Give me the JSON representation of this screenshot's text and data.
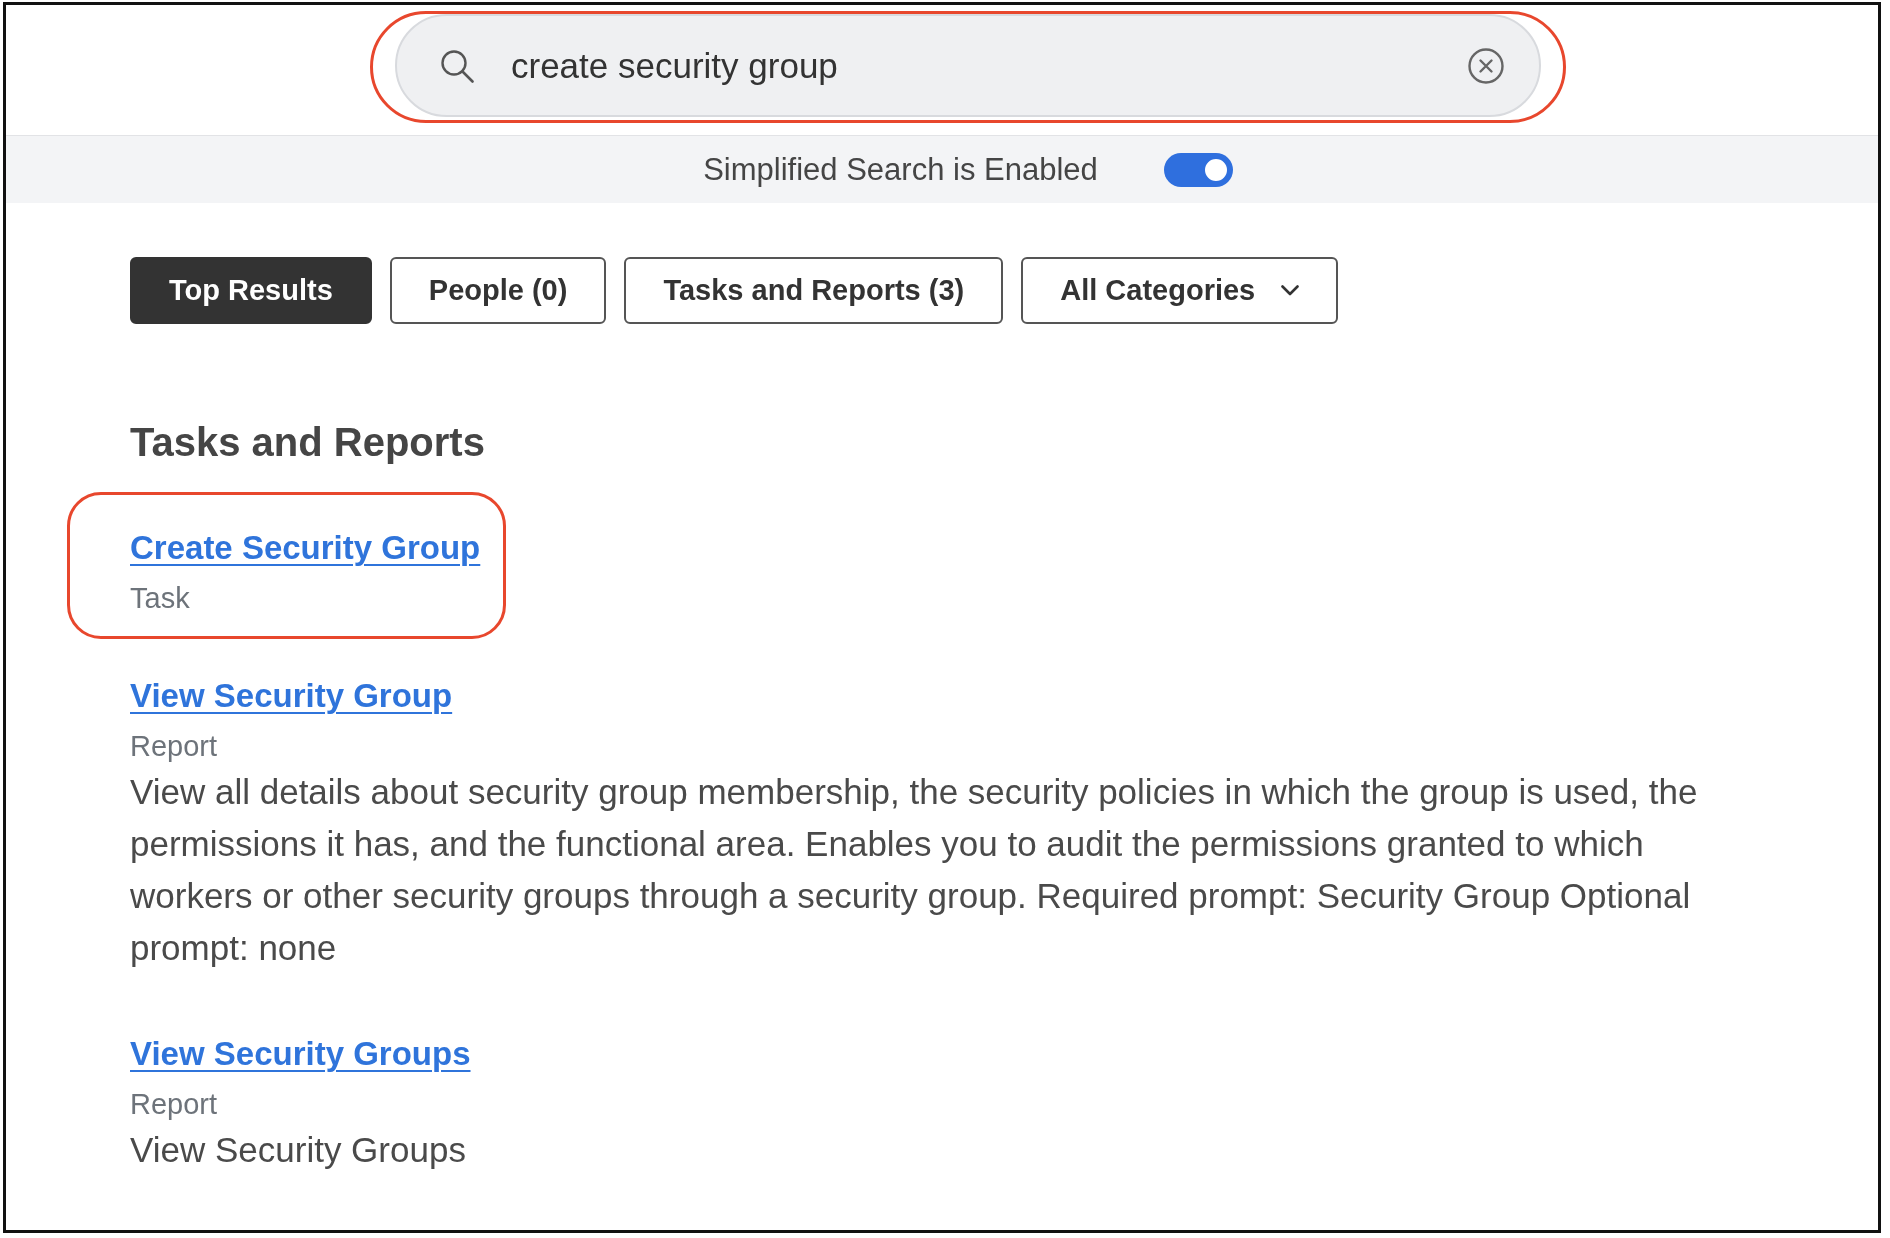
{
  "search": {
    "value": "create security group",
    "highlighted": true
  },
  "simplified_search": {
    "label": "Simplified Search is Enabled",
    "on": true
  },
  "filters": [
    {
      "label": "Top Results",
      "kind": "tab",
      "selected": true
    },
    {
      "label": "People (0)",
      "kind": "tab",
      "selected": false
    },
    {
      "label": "Tasks and Reports (3)",
      "kind": "tab",
      "selected": false
    },
    {
      "label": "All Categories",
      "kind": "dropdown",
      "selected": false
    }
  ],
  "section": {
    "title": "Tasks and Reports",
    "results": [
      {
        "title": "Create Security Group",
        "type": "Task",
        "highlighted": true
      },
      {
        "title": "View Security Group",
        "type": "Report",
        "description": "View all details about security group membership, the security policies in which the group is used, the permissions it has, and the functional area. Enables you to audit the permissions granted to which workers or other security groups through a security group. Required prompt: Security Group Optional prompt: none",
        "highlighted": false
      },
      {
        "title": "View Security Groups",
        "type": "Report",
        "description": "View Security Groups",
        "highlighted": false
      }
    ]
  }
}
